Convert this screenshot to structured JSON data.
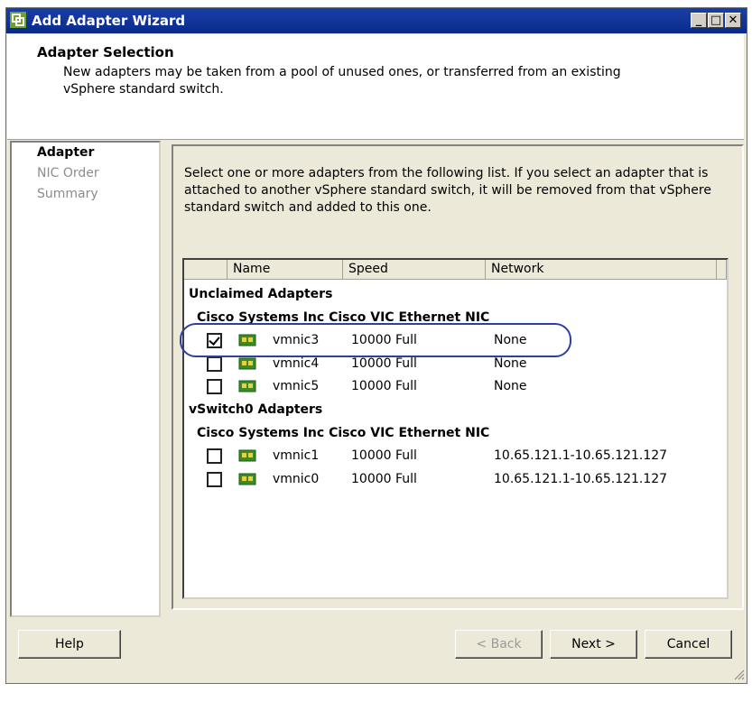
{
  "window": {
    "title": "Add Adapter Wizard",
    "minimize": "_",
    "maximize": "□",
    "close": "✕"
  },
  "header": {
    "title": "Adapter Selection",
    "description": "New adapters may be taken from a pool of unused ones, or transferred from an existing vSphere standard switch."
  },
  "steps": [
    "Adapter",
    "NIC Order",
    "Summary"
  ],
  "content": {
    "instructions": "Select one or more adapters from the following list. If you select an adapter that is attached to another vSphere standard switch, it will be removed from that vSphere standard switch and added to this one."
  },
  "table": {
    "columns": [
      "Name",
      "Speed",
      "Network"
    ],
    "groups": [
      {
        "label": "Unclaimed Adapters",
        "vendor": "Cisco Systems Inc Cisco VIC Ethernet NIC",
        "rows": [
          {
            "checked": true,
            "name": "vmnic3",
            "speed": "10000 Full",
            "network": "None"
          },
          {
            "checked": false,
            "name": "vmnic4",
            "speed": "10000 Full",
            "network": "None"
          },
          {
            "checked": false,
            "name": "vmnic5",
            "speed": "10000 Full",
            "network": "None"
          }
        ]
      },
      {
        "label": "vSwitch0 Adapters",
        "vendor": "Cisco Systems Inc Cisco VIC Ethernet NIC",
        "rows": [
          {
            "checked": false,
            "name": "vmnic1",
            "speed": "10000 Full",
            "network": "10.65.121.1-10.65.121.127"
          },
          {
            "checked": false,
            "name": "vmnic0",
            "speed": "10000 Full",
            "network": "10.65.121.1-10.65.121.127"
          }
        ]
      }
    ]
  },
  "buttons": {
    "help": "Help",
    "back": "< Back",
    "next": "Next >",
    "cancel": "Cancel"
  },
  "colors": {
    "titlebar": "#0a2a8c",
    "highlight_circle": "#2c3fa6",
    "nic_icon": "#3a8c2a"
  }
}
